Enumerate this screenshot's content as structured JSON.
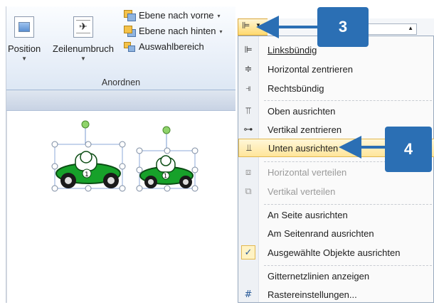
{
  "ribbon": {
    "position_label": "Position",
    "wrap_label": "Zeilenumbruch",
    "bring_forward": "Ebene nach vorne",
    "send_backward": "Ebene nach hinten",
    "selection_pane": "Auswahlbereich",
    "group_label": "Anordnen"
  },
  "menu": {
    "items": [
      {
        "label": "Linksbündig",
        "icon": "align-left-icon",
        "disabled": false
      },
      {
        "label": "Horizontal zentrieren",
        "icon": "align-center-icon",
        "disabled": false
      },
      {
        "label": "Rechtsbündig",
        "icon": "align-right-icon",
        "disabled": false
      },
      {
        "label": "Oben ausrichten",
        "icon": "align-top-icon",
        "disabled": false
      },
      {
        "label": "Vertikal zentrieren",
        "icon": "align-middle-icon",
        "disabled": false
      },
      {
        "label": "Unten ausrichten",
        "icon": "align-bottom-icon",
        "disabled": false,
        "highlighted": true
      },
      {
        "label": "Horizontal verteilen",
        "icon": "distribute-horizontal-icon",
        "disabled": true
      },
      {
        "label": "Vertikal verteilen",
        "icon": "distribute-vertical-icon",
        "disabled": true
      },
      {
        "label": "An Seite ausrichten",
        "disabled": false
      },
      {
        "label": "Am Seitenrand ausrichten",
        "disabled": false
      },
      {
        "label": "Ausgewählte Objekte ausrichten",
        "checked": true,
        "disabled": false
      },
      {
        "label": "Gitternetzlinien anzeigen",
        "disabled": false
      },
      {
        "label": "Rastereinstellungen...",
        "icon": "grid-icon",
        "disabled": false
      }
    ]
  },
  "callouts": {
    "step3": "3",
    "step4": "4"
  },
  "colors": {
    "accent": "#2b6fb4",
    "highlight": "#ffe59a",
    "car_green": "#17a12a"
  }
}
